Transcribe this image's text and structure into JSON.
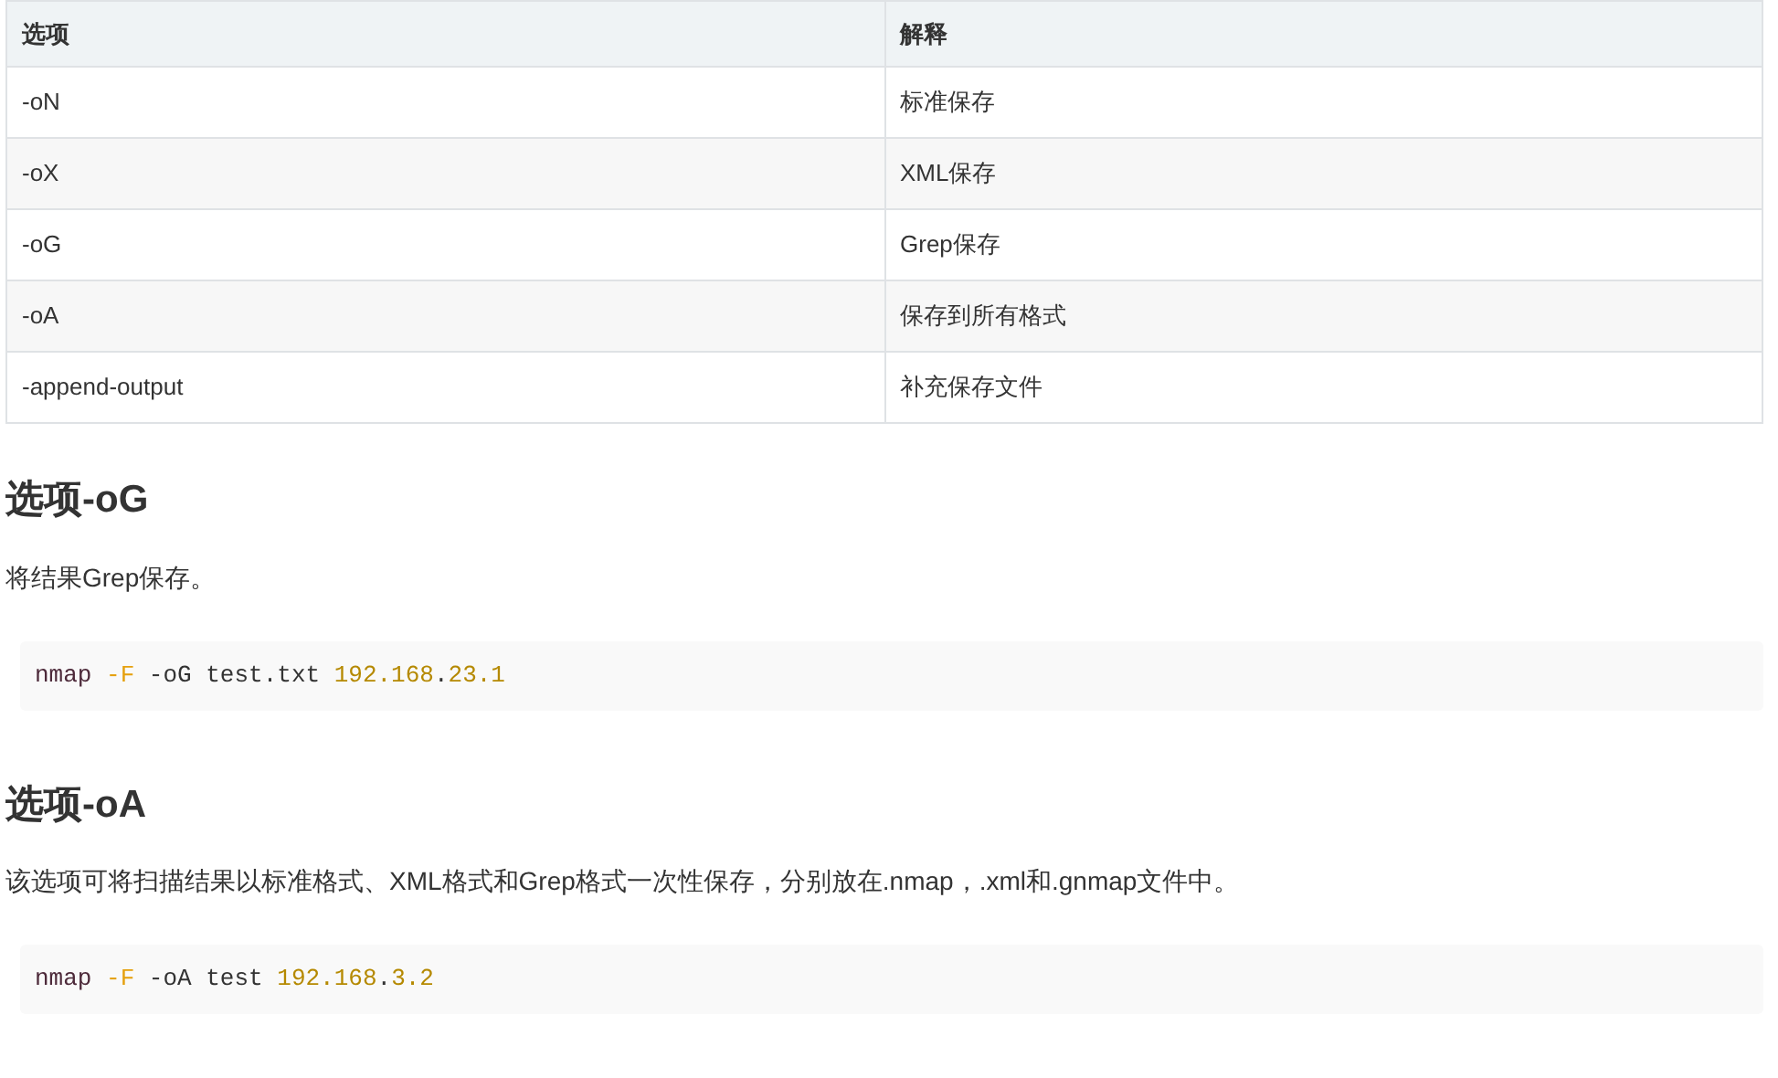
{
  "table": {
    "columns": [
      "选项",
      "解释"
    ],
    "rows": [
      [
        "-oN",
        "标准保存"
      ],
      [
        "-oX",
        "XML保存"
      ],
      [
        "-oG",
        "Grep保存"
      ],
      [
        "-oA",
        "保存到所有格式"
      ],
      [
        "-append-output",
        "补充保存文件"
      ]
    ]
  },
  "sections": [
    {
      "heading": "选项-oG",
      "text": "将结果Grep保存。",
      "code": [
        {
          "text": "nmap ",
          "kind": "command"
        },
        {
          "text": "-F",
          "kind": "flag"
        },
        {
          "text": " -oG test.txt ",
          "kind": "plain"
        },
        {
          "text": "192.168",
          "kind": "number"
        },
        {
          "text": ".",
          "kind": "plain"
        },
        {
          "text": "23.1",
          "kind": "number"
        }
      ]
    },
    {
      "heading": "选项-oA",
      "text": "该选项可将扫描结果以标准格式、XML格式和Grep格式一次性保存，分别放在.nmap，.xml和.gnmap文件中。",
      "code": [
        {
          "text": "nmap ",
          "kind": "command"
        },
        {
          "text": "-F",
          "kind": "flag"
        },
        {
          "text": " -oA test ",
          "kind": "plain"
        },
        {
          "text": "192.168",
          "kind": "number"
        },
        {
          "text": ".",
          "kind": "plain"
        },
        {
          "text": "3.2",
          "kind": "number"
        }
      ]
    }
  ]
}
